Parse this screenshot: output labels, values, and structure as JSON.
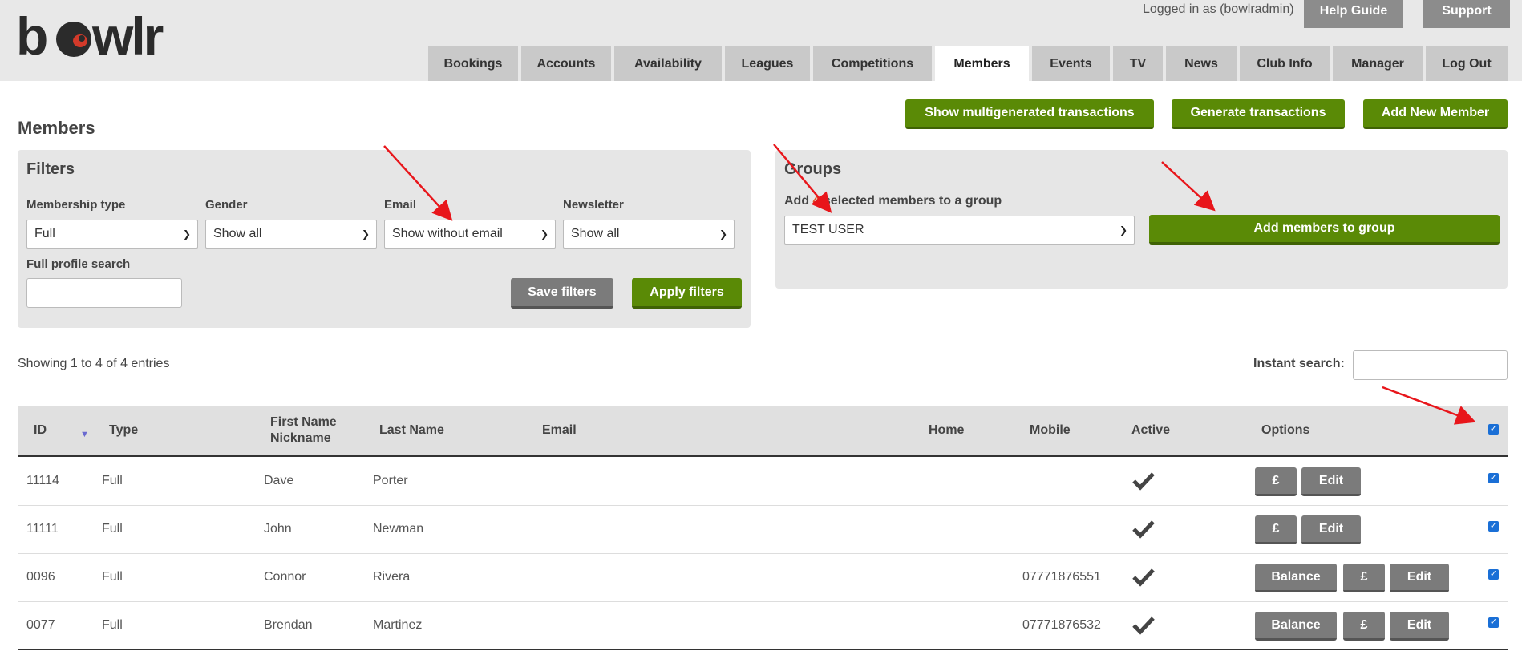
{
  "header": {
    "logo_text": "bowlr",
    "logged_in": "Logged in as (bowlradmin)",
    "help_label": "Help Guide",
    "support_label": "Support"
  },
  "nav": {
    "tabs": [
      {
        "label": "Bookings"
      },
      {
        "label": "Accounts"
      },
      {
        "label": "Availability"
      },
      {
        "label": "Leagues"
      },
      {
        "label": "Competitions"
      },
      {
        "label": "Members",
        "active": true
      },
      {
        "label": "Events"
      },
      {
        "label": "TV"
      },
      {
        "label": "News"
      },
      {
        "label": "Club Info"
      },
      {
        "label": "Manager"
      },
      {
        "label": "Log Out"
      }
    ]
  },
  "actions": {
    "multigenerated": "Show multigenerated transactions",
    "generate": "Generate transactions",
    "add_member": "Add New Member"
  },
  "page_title": "Members",
  "filters": {
    "heading": "Filters",
    "membership_type": {
      "label": "Membership type",
      "value": "Full"
    },
    "gender": {
      "label": "Gender",
      "value": "Show all"
    },
    "email": {
      "label": "Email",
      "value": "Show without email"
    },
    "newsletter": {
      "label": "Newsletter",
      "value": "Show all"
    },
    "profile_search": {
      "label": "Full profile search",
      "value": ""
    },
    "save_label": "Save filters",
    "apply_label": "Apply filters"
  },
  "groups": {
    "heading": "Groups",
    "add_prefix": "Add ",
    "selected_count": "4",
    "add_suffix": " selected members to a group",
    "group_value": "TEST USER",
    "add_button": "Add members to group"
  },
  "table_info": {
    "showing": "Showing 1 to 4 of 4 entries",
    "instant_search_label": "Instant search:",
    "instant_search_value": ""
  },
  "table": {
    "headers": {
      "id": "ID",
      "type": "Type",
      "first_name": "First Name",
      "nickname": "Nickname",
      "last_name": "Last Name",
      "email": "Email",
      "home": "Home",
      "mobile": "Mobile",
      "active": "Active",
      "options": "Options"
    },
    "header_checked": true,
    "rows": [
      {
        "id": "11114",
        "type": "Full",
        "first": "Dave",
        "last": "Porter",
        "email": "",
        "home": "",
        "mobile": "",
        "active": true,
        "checked": true
      },
      {
        "id": "11111",
        "type": "Full",
        "first": "John",
        "last": "Newman",
        "email": "",
        "home": "",
        "mobile": "",
        "active": true,
        "checked": true
      },
      {
        "id": "0096",
        "type": "Full",
        "first": "Connor",
        "last": "Rivera",
        "email": "",
        "home": "",
        "mobile": "07771876551",
        "active": true,
        "checked": true
      },
      {
        "id": "0077",
        "type": "Full",
        "first": "Brendan",
        "last": "Martinez",
        "email": "",
        "home": "",
        "mobile": "07771876532",
        "active": true,
        "checked": true
      }
    ],
    "option_labels": {
      "balance": "Balance",
      "pound": "£",
      "edit": "Edit"
    }
  },
  "colors": {
    "accent_green": "#5a8a06",
    "grey_button": "#7b7b7b",
    "annotation_red": "#e8161b",
    "count_highlight": "#e0522a"
  }
}
